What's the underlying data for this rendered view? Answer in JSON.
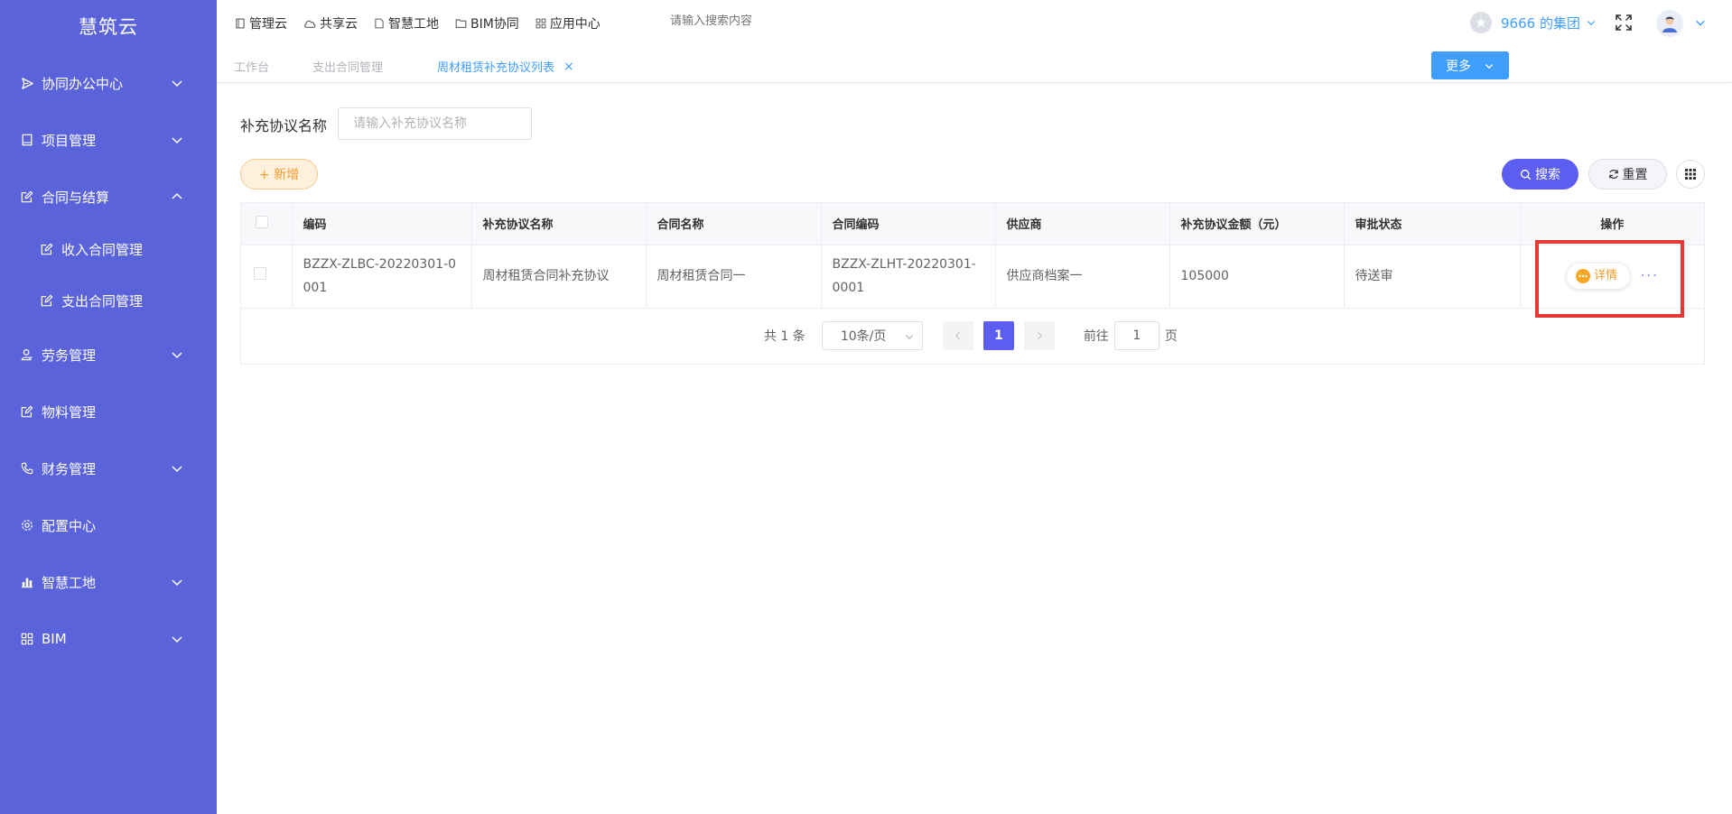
{
  "app": {
    "title": "慧筑云"
  },
  "sidebar": {
    "items": [
      {
        "label": "协同办公中心"
      },
      {
        "label": "项目管理"
      },
      {
        "label": "合同与结算"
      },
      {
        "label": "收入合同管理"
      },
      {
        "label": "支出合同管理"
      },
      {
        "label": "劳务管理"
      },
      {
        "label": "物料管理"
      },
      {
        "label": "财务管理"
      },
      {
        "label": "配置中心"
      },
      {
        "label": "智慧工地"
      },
      {
        "label": "BIM"
      }
    ]
  },
  "topnav": {
    "items": [
      {
        "label": "管理云"
      },
      {
        "label": "共享云"
      },
      {
        "label": "智慧工地"
      },
      {
        "label": "BIM协同"
      },
      {
        "label": "应用中心"
      }
    ],
    "search_placeholder": "请输入搜索内容",
    "group_name": "9666 的集团"
  },
  "tabs": {
    "items": [
      {
        "label": "工作台"
      },
      {
        "label": "支出合同管理"
      },
      {
        "label": "周材租赁补充协议列表"
      }
    ],
    "close_symbol": "×",
    "more_label": "更多"
  },
  "filter": {
    "label": "补充协议名称",
    "placeholder": "请输入补充协议名称"
  },
  "toolbar": {
    "add_label": "+ 新增",
    "search_label": "搜索",
    "reset_label": "重置"
  },
  "table": {
    "headers": [
      "编码",
      "补充协议名称",
      "合同名称",
      "合同编码",
      "供应商",
      "补充协议金额（元）",
      "审批状态",
      "操作"
    ],
    "rows": [
      {
        "code": "BZZX-ZLBC-20220301-0001",
        "agreement_name": "周材租赁合同补充协议",
        "contract_name": "周材租赁合同一",
        "contract_code": "BZZX-ZLHT-20220301-0001",
        "supplier": "供应商档案一",
        "amount": "105000",
        "status": "待送审"
      }
    ],
    "detail_label": "详情",
    "more_label": "···"
  },
  "pagination": {
    "total_text": "共 1 条",
    "page_size": "10条/页",
    "current_page": "1",
    "goto_prefix": "前往",
    "goto_value": "1",
    "goto_suffix": "页"
  },
  "colors": {
    "sidebar_bg": "#5b63db",
    "primary": "#5b5ef0",
    "link_blue": "#409eff",
    "orange": "#f19c2c",
    "highlight_red": "#e53935"
  }
}
